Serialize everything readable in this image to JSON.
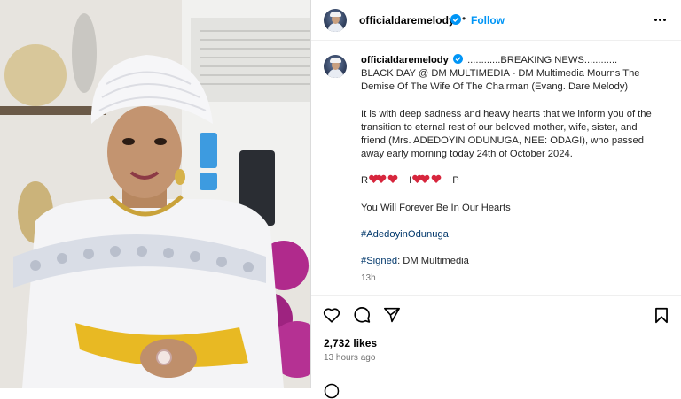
{
  "post": {
    "username": "officialdaremelody",
    "follow_label": "Follow",
    "dot": "•",
    "caption_lines": [
      "............BREAKING NEWS............",
      "BLACK DAY @ DM MULTIMEDIA - DM Multimedia Mourns The Demise Of The Wife Of The Chairman (Evang. Dare Melody)",
      "It is with deep sadness and heavy hearts that we inform you of the transition to eternal rest of our beloved mother, wife, sister, and friend (Mrs. ADEDOYIN ODUNUGA, NEE: ODAGI), who passed away early morning today 24th of October 2024.",
      "You Will Forever Be In Our Hearts"
    ],
    "rip_prefix": "R",
    "rip_mid": "I",
    "rip_suffix": "P",
    "hashtag": "#AdedoyinOdunuga",
    "signed_tag": "#Signed",
    "signed_text": ": DM Multimedia",
    "caption_time": "13h",
    "likes": "2,732 likes",
    "time_ago": "13 hours ago"
  },
  "icons": {
    "verified": "verified-badge-icon",
    "more": "more-options-icon",
    "like": "heart-icon",
    "comment": "comment-icon",
    "share": "send-icon",
    "save": "bookmark-icon",
    "emoji_heart": "red-heart-emoji"
  },
  "colors": {
    "link": "#0095f6",
    "hashtag": "#00376b",
    "heart_red": "#d7263d",
    "secondary_text": "#737373"
  }
}
